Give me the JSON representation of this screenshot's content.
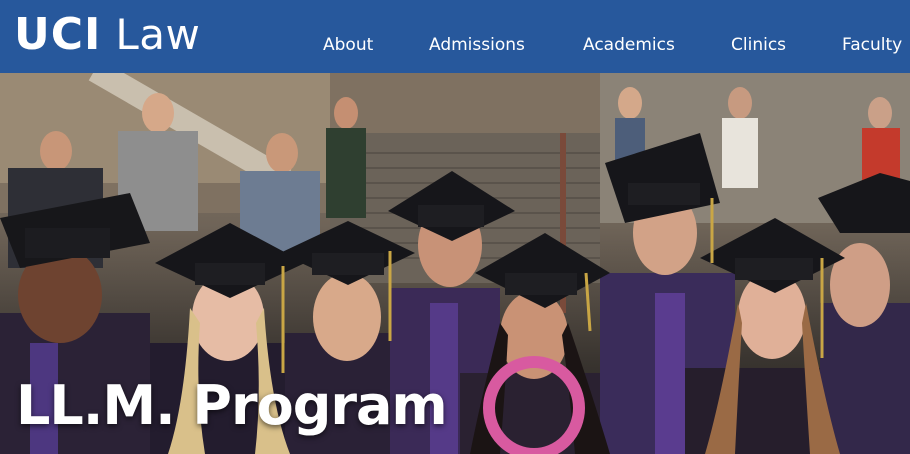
{
  "header": {
    "logo": {
      "primary": "UCI",
      "secondary": "Law"
    },
    "nav": [
      {
        "label": "About"
      },
      {
        "label": "Admissions"
      },
      {
        "label": "Academics"
      },
      {
        "label": "Clinics"
      },
      {
        "label": "Faculty"
      }
    ],
    "background_color": "#27589c"
  },
  "hero": {
    "title": "LL.M. Program",
    "image_subject": "graduates in caps and gowns"
  }
}
